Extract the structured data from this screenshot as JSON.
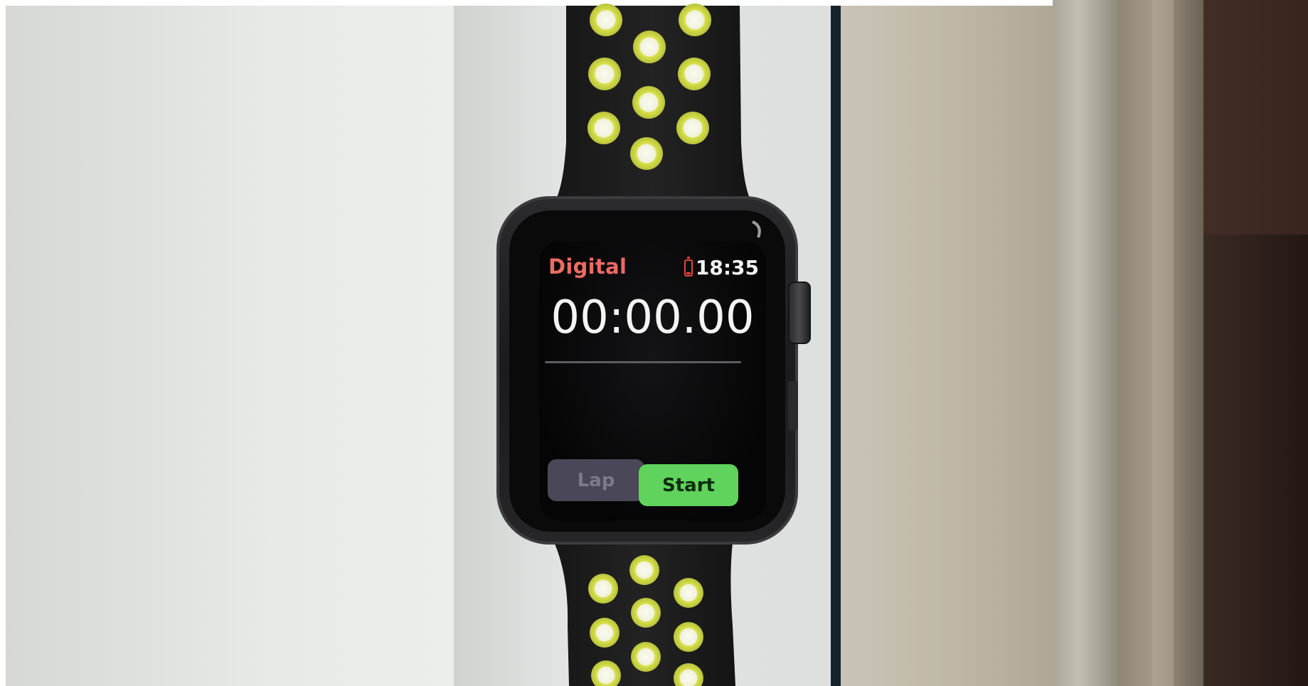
{
  "watch_app": {
    "title": "Digital",
    "status_time": "18:35",
    "elapsed_time": "00:00.00",
    "lap_label": "Lap",
    "start_label": "Start"
  },
  "icons": {
    "battery": "battery-low-icon",
    "crown": "digital-crown-icon"
  },
  "colors": {
    "title_accent": "#ee6a63",
    "battery_warning": "#e8453c",
    "start_button": "#5fd35b",
    "lap_button": "#4a4758",
    "band_perforation": "#d6e04a"
  }
}
